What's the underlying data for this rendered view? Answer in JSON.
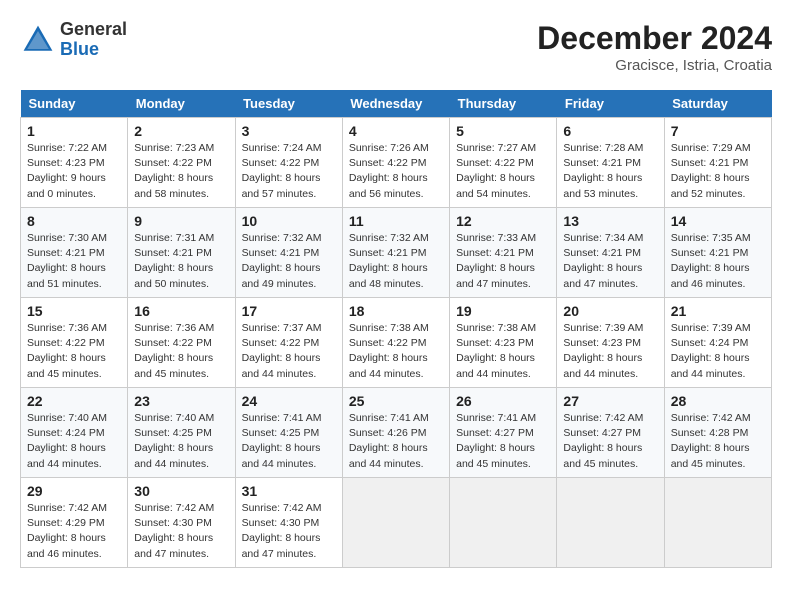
{
  "header": {
    "logo_line1": "General",
    "logo_line2": "Blue",
    "month_year": "December 2024",
    "location": "Gracisce, Istria, Croatia"
  },
  "days_of_week": [
    "Sunday",
    "Monday",
    "Tuesday",
    "Wednesday",
    "Thursday",
    "Friday",
    "Saturday"
  ],
  "weeks": [
    [
      {
        "day": "1",
        "sunrise": "7:22 AM",
        "sunset": "4:23 PM",
        "daylight": "9 hours and 0 minutes."
      },
      {
        "day": "2",
        "sunrise": "7:23 AM",
        "sunset": "4:22 PM",
        "daylight": "8 hours and 58 minutes."
      },
      {
        "day": "3",
        "sunrise": "7:24 AM",
        "sunset": "4:22 PM",
        "daylight": "8 hours and 57 minutes."
      },
      {
        "day": "4",
        "sunrise": "7:26 AM",
        "sunset": "4:22 PM",
        "daylight": "8 hours and 56 minutes."
      },
      {
        "day": "5",
        "sunrise": "7:27 AM",
        "sunset": "4:22 PM",
        "daylight": "8 hours and 54 minutes."
      },
      {
        "day": "6",
        "sunrise": "7:28 AM",
        "sunset": "4:21 PM",
        "daylight": "8 hours and 53 minutes."
      },
      {
        "day": "7",
        "sunrise": "7:29 AM",
        "sunset": "4:21 PM",
        "daylight": "8 hours and 52 minutes."
      }
    ],
    [
      {
        "day": "8",
        "sunrise": "7:30 AM",
        "sunset": "4:21 PM",
        "daylight": "8 hours and 51 minutes."
      },
      {
        "day": "9",
        "sunrise": "7:31 AM",
        "sunset": "4:21 PM",
        "daylight": "8 hours and 50 minutes."
      },
      {
        "day": "10",
        "sunrise": "7:32 AM",
        "sunset": "4:21 PM",
        "daylight": "8 hours and 49 minutes."
      },
      {
        "day": "11",
        "sunrise": "7:32 AM",
        "sunset": "4:21 PM",
        "daylight": "8 hours and 48 minutes."
      },
      {
        "day": "12",
        "sunrise": "7:33 AM",
        "sunset": "4:21 PM",
        "daylight": "8 hours and 47 minutes."
      },
      {
        "day": "13",
        "sunrise": "7:34 AM",
        "sunset": "4:21 PM",
        "daylight": "8 hours and 47 minutes."
      },
      {
        "day": "14",
        "sunrise": "7:35 AM",
        "sunset": "4:21 PM",
        "daylight": "8 hours and 46 minutes."
      }
    ],
    [
      {
        "day": "15",
        "sunrise": "7:36 AM",
        "sunset": "4:22 PM",
        "daylight": "8 hours and 45 minutes."
      },
      {
        "day": "16",
        "sunrise": "7:36 AM",
        "sunset": "4:22 PM",
        "daylight": "8 hours and 45 minutes."
      },
      {
        "day": "17",
        "sunrise": "7:37 AM",
        "sunset": "4:22 PM",
        "daylight": "8 hours and 44 minutes."
      },
      {
        "day": "18",
        "sunrise": "7:38 AM",
        "sunset": "4:22 PM",
        "daylight": "8 hours and 44 minutes."
      },
      {
        "day": "19",
        "sunrise": "7:38 AM",
        "sunset": "4:23 PM",
        "daylight": "8 hours and 44 minutes."
      },
      {
        "day": "20",
        "sunrise": "7:39 AM",
        "sunset": "4:23 PM",
        "daylight": "8 hours and 44 minutes."
      },
      {
        "day": "21",
        "sunrise": "7:39 AM",
        "sunset": "4:24 PM",
        "daylight": "8 hours and 44 minutes."
      }
    ],
    [
      {
        "day": "22",
        "sunrise": "7:40 AM",
        "sunset": "4:24 PM",
        "daylight": "8 hours and 44 minutes."
      },
      {
        "day": "23",
        "sunrise": "7:40 AM",
        "sunset": "4:25 PM",
        "daylight": "8 hours and 44 minutes."
      },
      {
        "day": "24",
        "sunrise": "7:41 AM",
        "sunset": "4:25 PM",
        "daylight": "8 hours and 44 minutes."
      },
      {
        "day": "25",
        "sunrise": "7:41 AM",
        "sunset": "4:26 PM",
        "daylight": "8 hours and 44 minutes."
      },
      {
        "day": "26",
        "sunrise": "7:41 AM",
        "sunset": "4:27 PM",
        "daylight": "8 hours and 45 minutes."
      },
      {
        "day": "27",
        "sunrise": "7:42 AM",
        "sunset": "4:27 PM",
        "daylight": "8 hours and 45 minutes."
      },
      {
        "day": "28",
        "sunrise": "7:42 AM",
        "sunset": "4:28 PM",
        "daylight": "8 hours and 45 minutes."
      }
    ],
    [
      {
        "day": "29",
        "sunrise": "7:42 AM",
        "sunset": "4:29 PM",
        "daylight": "8 hours and 46 minutes."
      },
      {
        "day": "30",
        "sunrise": "7:42 AM",
        "sunset": "4:30 PM",
        "daylight": "8 hours and 47 minutes."
      },
      {
        "day": "31",
        "sunrise": "7:42 AM",
        "sunset": "4:30 PM",
        "daylight": "8 hours and 47 minutes."
      },
      null,
      null,
      null,
      null
    ]
  ],
  "labels": {
    "sunrise": "Sunrise:",
    "sunset": "Sunset:",
    "daylight": "Daylight:"
  }
}
